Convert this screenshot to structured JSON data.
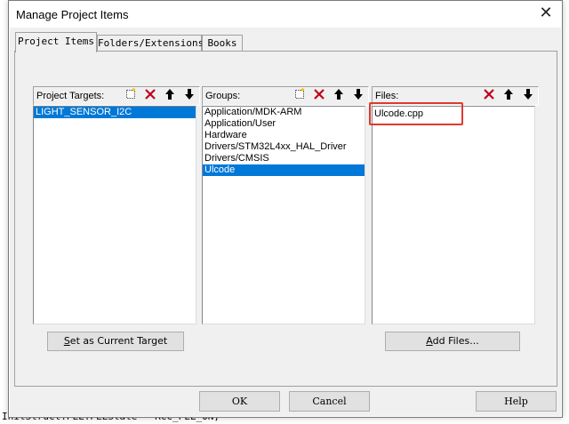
{
  "dialog": {
    "title": "Manage Project Items",
    "close_glyph": "✕"
  },
  "tabs": [
    {
      "label": "Project Items",
      "active": true
    },
    {
      "label": "Folders/Extensions",
      "active": false
    },
    {
      "label": "Books",
      "active": false
    }
  ],
  "targets": {
    "label": "Project Targets:",
    "items": [
      "LIGHT_SENSOR_I2C"
    ],
    "selected": "LIGHT_SENSOR_I2C"
  },
  "groups": {
    "label": "Groups:",
    "items": [
      "Application/MDK-ARM",
      "Application/User",
      "Hardware",
      "Drivers/STM32L4xx_HAL_Driver",
      "Drivers/CMSIS",
      "Ulcode"
    ],
    "selected": "Ulcode"
  },
  "files": {
    "label": "Files:",
    "items": [
      "Ulcode.cpp"
    ]
  },
  "buttons": {
    "set_current_prefix": "S",
    "set_current_rest": "et as Current Target",
    "add_files_prefix": "A",
    "add_files_rest": "dd Files...",
    "ok": "OK",
    "cancel": "Cancel",
    "help": "Help"
  },
  "icons": {
    "new": "new-item-icon",
    "delete": "delete-icon",
    "move_up": "arrow-up-icon",
    "move_down": "arrow-down-icon"
  },
  "colors": {
    "selection": "#0078d7",
    "highlight_box": "#e03a2f",
    "delete_red": "#c0001b"
  },
  "background_code": {
    "bottom_line": "InitStruct.PLL.PLLState = RCC_PLL_ON;"
  }
}
